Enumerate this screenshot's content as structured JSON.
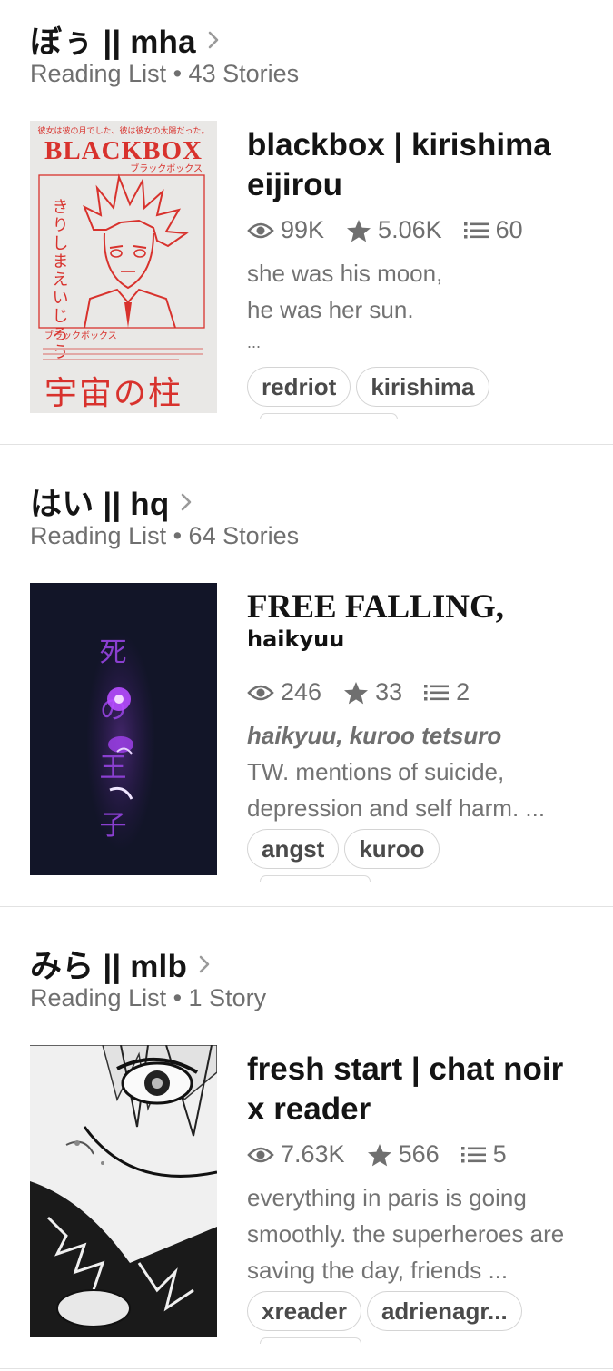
{
  "lists": [
    {
      "title": "ぼぅ || mha",
      "meta": "Reading List • 43 Stories",
      "story": {
        "title": "blackbox | kirishima eijirou",
        "cover": {
          "top_text": "彼女は彼の月でした、彼は彼女の太陽だった。",
          "logo": "BLACKBOX",
          "katakana": "ブラックボックス",
          "vertical_name": "きりしまえいじろう",
          "bottom_katakana": "ブラックボックス",
          "blurb": "破壊なるヴィンセントヴァンゴッホ、転倒りに乗ってサイレンに征服された彼に耳を傾けながら、リコリスとチューリップのフィールドに星空を描きますか",
          "big_text": "宇宙の柱"
        },
        "reads": "99K",
        "votes": "5.06K",
        "parts": "60",
        "description_lines": [
          "she was his moon,",
          "he was her sun.",
          "..."
        ],
        "tags": [
          "redriot",
          "kirishima"
        ]
      }
    },
    {
      "title": "はい || hq",
      "meta": "Reading List • 64 Stories",
      "story": {
        "title": "FREE FALLING,",
        "subtitle": "haikyuu",
        "cover": {
          "vertical_text": "死 の 王 子"
        },
        "reads": "246",
        "votes": "33",
        "parts": "2",
        "fandom_line": "haikyuu, kuroo tetsuro",
        "description": "TW. mentions of suicide, depression and self harm. ...",
        "tags": [
          "angst",
          "kuroo"
        ]
      }
    },
    {
      "title": "みら || mlb",
      "meta": "Reading List • 1 Story",
      "story": {
        "title": "fresh start | chat noir x reader",
        "reads": "7.63K",
        "votes": "566",
        "parts": "5",
        "description": "everything in paris is going smoothly. the superheroes are saving the day, friends ...",
        "tags": [
          "xreader",
          "adrienagr..."
        ]
      }
    }
  ],
  "icons": {
    "reads": "eye-icon",
    "votes": "star-icon",
    "parts": "list-icon",
    "more": "chevron-right-icon"
  },
  "colors": {
    "text": "#141414",
    "muted": "#6f6f6f",
    "border": "#d4d4d4",
    "cover_red": "#d8322d"
  }
}
